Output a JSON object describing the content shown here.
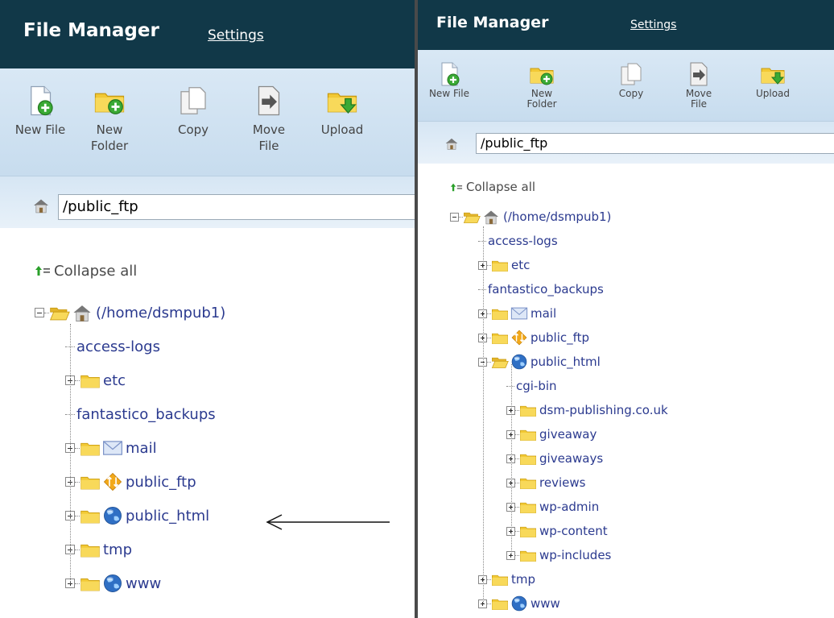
{
  "left_panel": {
    "header": {
      "title": "File Manager",
      "settings_link": "Settings"
    },
    "toolbar": [
      {
        "id": "new-file",
        "icon": "new-file-icon",
        "line1": "New File",
        "line2": ""
      },
      {
        "id": "new-folder",
        "icon": "new-folder-icon",
        "line1": "New",
        "line2": "Folder"
      },
      {
        "id": "copy",
        "icon": "copy-icon",
        "line1": "Copy",
        "line2": ""
      },
      {
        "id": "move-file",
        "icon": "move-file-icon",
        "line1": "Move",
        "line2": "File"
      },
      {
        "id": "upload",
        "icon": "upload-icon",
        "line1": "Upload",
        "line2": ""
      }
    ],
    "path": {
      "value": "/public_ftp"
    },
    "tree": {
      "collapse_all": "Collapse all",
      "root": "(/home/dsmpub1)",
      "items": [
        {
          "label": "access-logs",
          "type": "leaf"
        },
        {
          "label": "etc",
          "type": "folder",
          "icon": "folder-icon"
        },
        {
          "label": "fantastico_backups",
          "type": "leaf"
        },
        {
          "label": "mail",
          "type": "folder",
          "icon": "mail-icon"
        },
        {
          "label": "public_ftp",
          "type": "folder",
          "icon": "ftp-icon"
        },
        {
          "label": "public_html",
          "type": "folder",
          "icon": "globe-icon"
        },
        {
          "label": "tmp",
          "type": "folder",
          "icon": "folder-icon"
        },
        {
          "label": "www",
          "type": "folder",
          "icon": "globe-icon"
        }
      ]
    }
  },
  "right_panel": {
    "header": {
      "title": "File Manager",
      "settings_link": "Settings"
    },
    "toolbar": [
      {
        "id": "new-file",
        "icon": "new-file-icon",
        "line1": "New File",
        "line2": ""
      },
      {
        "id": "new-folder",
        "icon": "new-folder-icon",
        "line1": "New",
        "line2": "Folder"
      },
      {
        "id": "copy",
        "icon": "copy-icon",
        "line1": "Copy",
        "line2": ""
      },
      {
        "id": "move-file",
        "icon": "move-file-icon",
        "line1": "Move",
        "line2": "File"
      },
      {
        "id": "upload",
        "icon": "upload-icon",
        "line1": "Upload",
        "line2": ""
      }
    ],
    "path": {
      "value": "/public_ftp"
    },
    "tree": {
      "collapse_all": "Collapse all",
      "root": "(/home/dsmpub1)",
      "items": [
        {
          "label": "access-logs",
          "type": "leaf"
        },
        {
          "label": "etc",
          "type": "folder",
          "icon": "folder-icon"
        },
        {
          "label": "fantastico_backups",
          "type": "leaf"
        },
        {
          "label": "mail",
          "type": "folder",
          "icon": "mail-icon"
        },
        {
          "label": "public_ftp",
          "type": "folder",
          "icon": "ftp-icon"
        },
        {
          "label": "public_html",
          "type": "folder-open",
          "icon": "globe-icon",
          "children": [
            {
              "label": "cgi-bin",
              "type": "leaf"
            },
            {
              "label": "dsm-publishing.co.uk",
              "type": "folder",
              "icon": "folder-icon"
            },
            {
              "label": "giveaway",
              "type": "folder",
              "icon": "folder-icon"
            },
            {
              "label": "giveaways",
              "type": "folder",
              "icon": "folder-icon"
            },
            {
              "label": "reviews",
              "type": "folder",
              "icon": "folder-icon"
            },
            {
              "label": "wp-admin",
              "type": "folder",
              "icon": "folder-icon"
            },
            {
              "label": "wp-content",
              "type": "folder",
              "icon": "folder-icon"
            },
            {
              "label": "wp-includes",
              "type": "folder",
              "icon": "folder-icon"
            }
          ]
        },
        {
          "label": "tmp",
          "type": "folder",
          "icon": "folder-icon"
        },
        {
          "label": "www",
          "type": "folder",
          "icon": "globe-icon"
        }
      ]
    }
  },
  "colors": {
    "header_bg": "#113848",
    "link_text": "#2b3a8f",
    "toolbar_bg": "#cfe1f1",
    "folder": "#f2c935"
  }
}
